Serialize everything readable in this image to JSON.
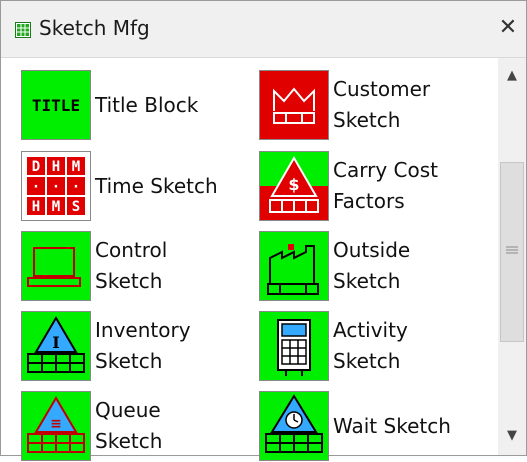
{
  "window": {
    "title": "Sketch Mfg",
    "close_glyph": "✕",
    "icon": "grid-icon"
  },
  "items": [
    {
      "label_lines": [
        "Title Block"
      ],
      "icon": "title-block-icon",
      "tile_color": "#00ee00",
      "tile_text": "TITLE"
    },
    {
      "label_lines": [
        "Customer",
        "Sketch"
      ],
      "icon": "customer-crown-icon",
      "tile_color": "#e00000"
    },
    {
      "label_lines": [
        "Time Sketch"
      ],
      "icon": "time-grid-icon",
      "tile_color": "#ffffff",
      "grid_letters": [
        "D",
        "H",
        "M",
        "·",
        "·",
        "·",
        "H",
        "M",
        "S"
      ]
    },
    {
      "label_lines": [
        "Carry Cost",
        "Factors"
      ],
      "icon": "carry-cost-icon",
      "tile_color": "#00ee00",
      "tile_symbol": "$"
    },
    {
      "label_lines": [
        "Control",
        "Sketch"
      ],
      "icon": "control-monitor-icon",
      "tile_color": "#00ee00"
    },
    {
      "label_lines": [
        "Outside",
        "Sketch"
      ],
      "icon": "factory-icon",
      "tile_color": "#00ee00"
    },
    {
      "label_lines": [
        "Inventory",
        "Sketch"
      ],
      "icon": "inventory-triangle-icon",
      "tile_color": "#00ee00",
      "tile_symbol": "I"
    },
    {
      "label_lines": [
        "Activity",
        "Sketch"
      ],
      "icon": "calculator-icon",
      "tile_color": "#00ee00"
    },
    {
      "label_lines": [
        "Queue",
        "Sketch"
      ],
      "icon": "queue-triangle-icon",
      "tile_color": "#00ee00",
      "tile_symbol": "≡"
    },
    {
      "label_lines": [
        "Wait Sketch"
      ],
      "icon": "wait-clock-icon",
      "tile_color": "#00ee00"
    }
  ],
  "scrollbar": {
    "up_glyph": "▲",
    "down_glyph": "▼"
  }
}
